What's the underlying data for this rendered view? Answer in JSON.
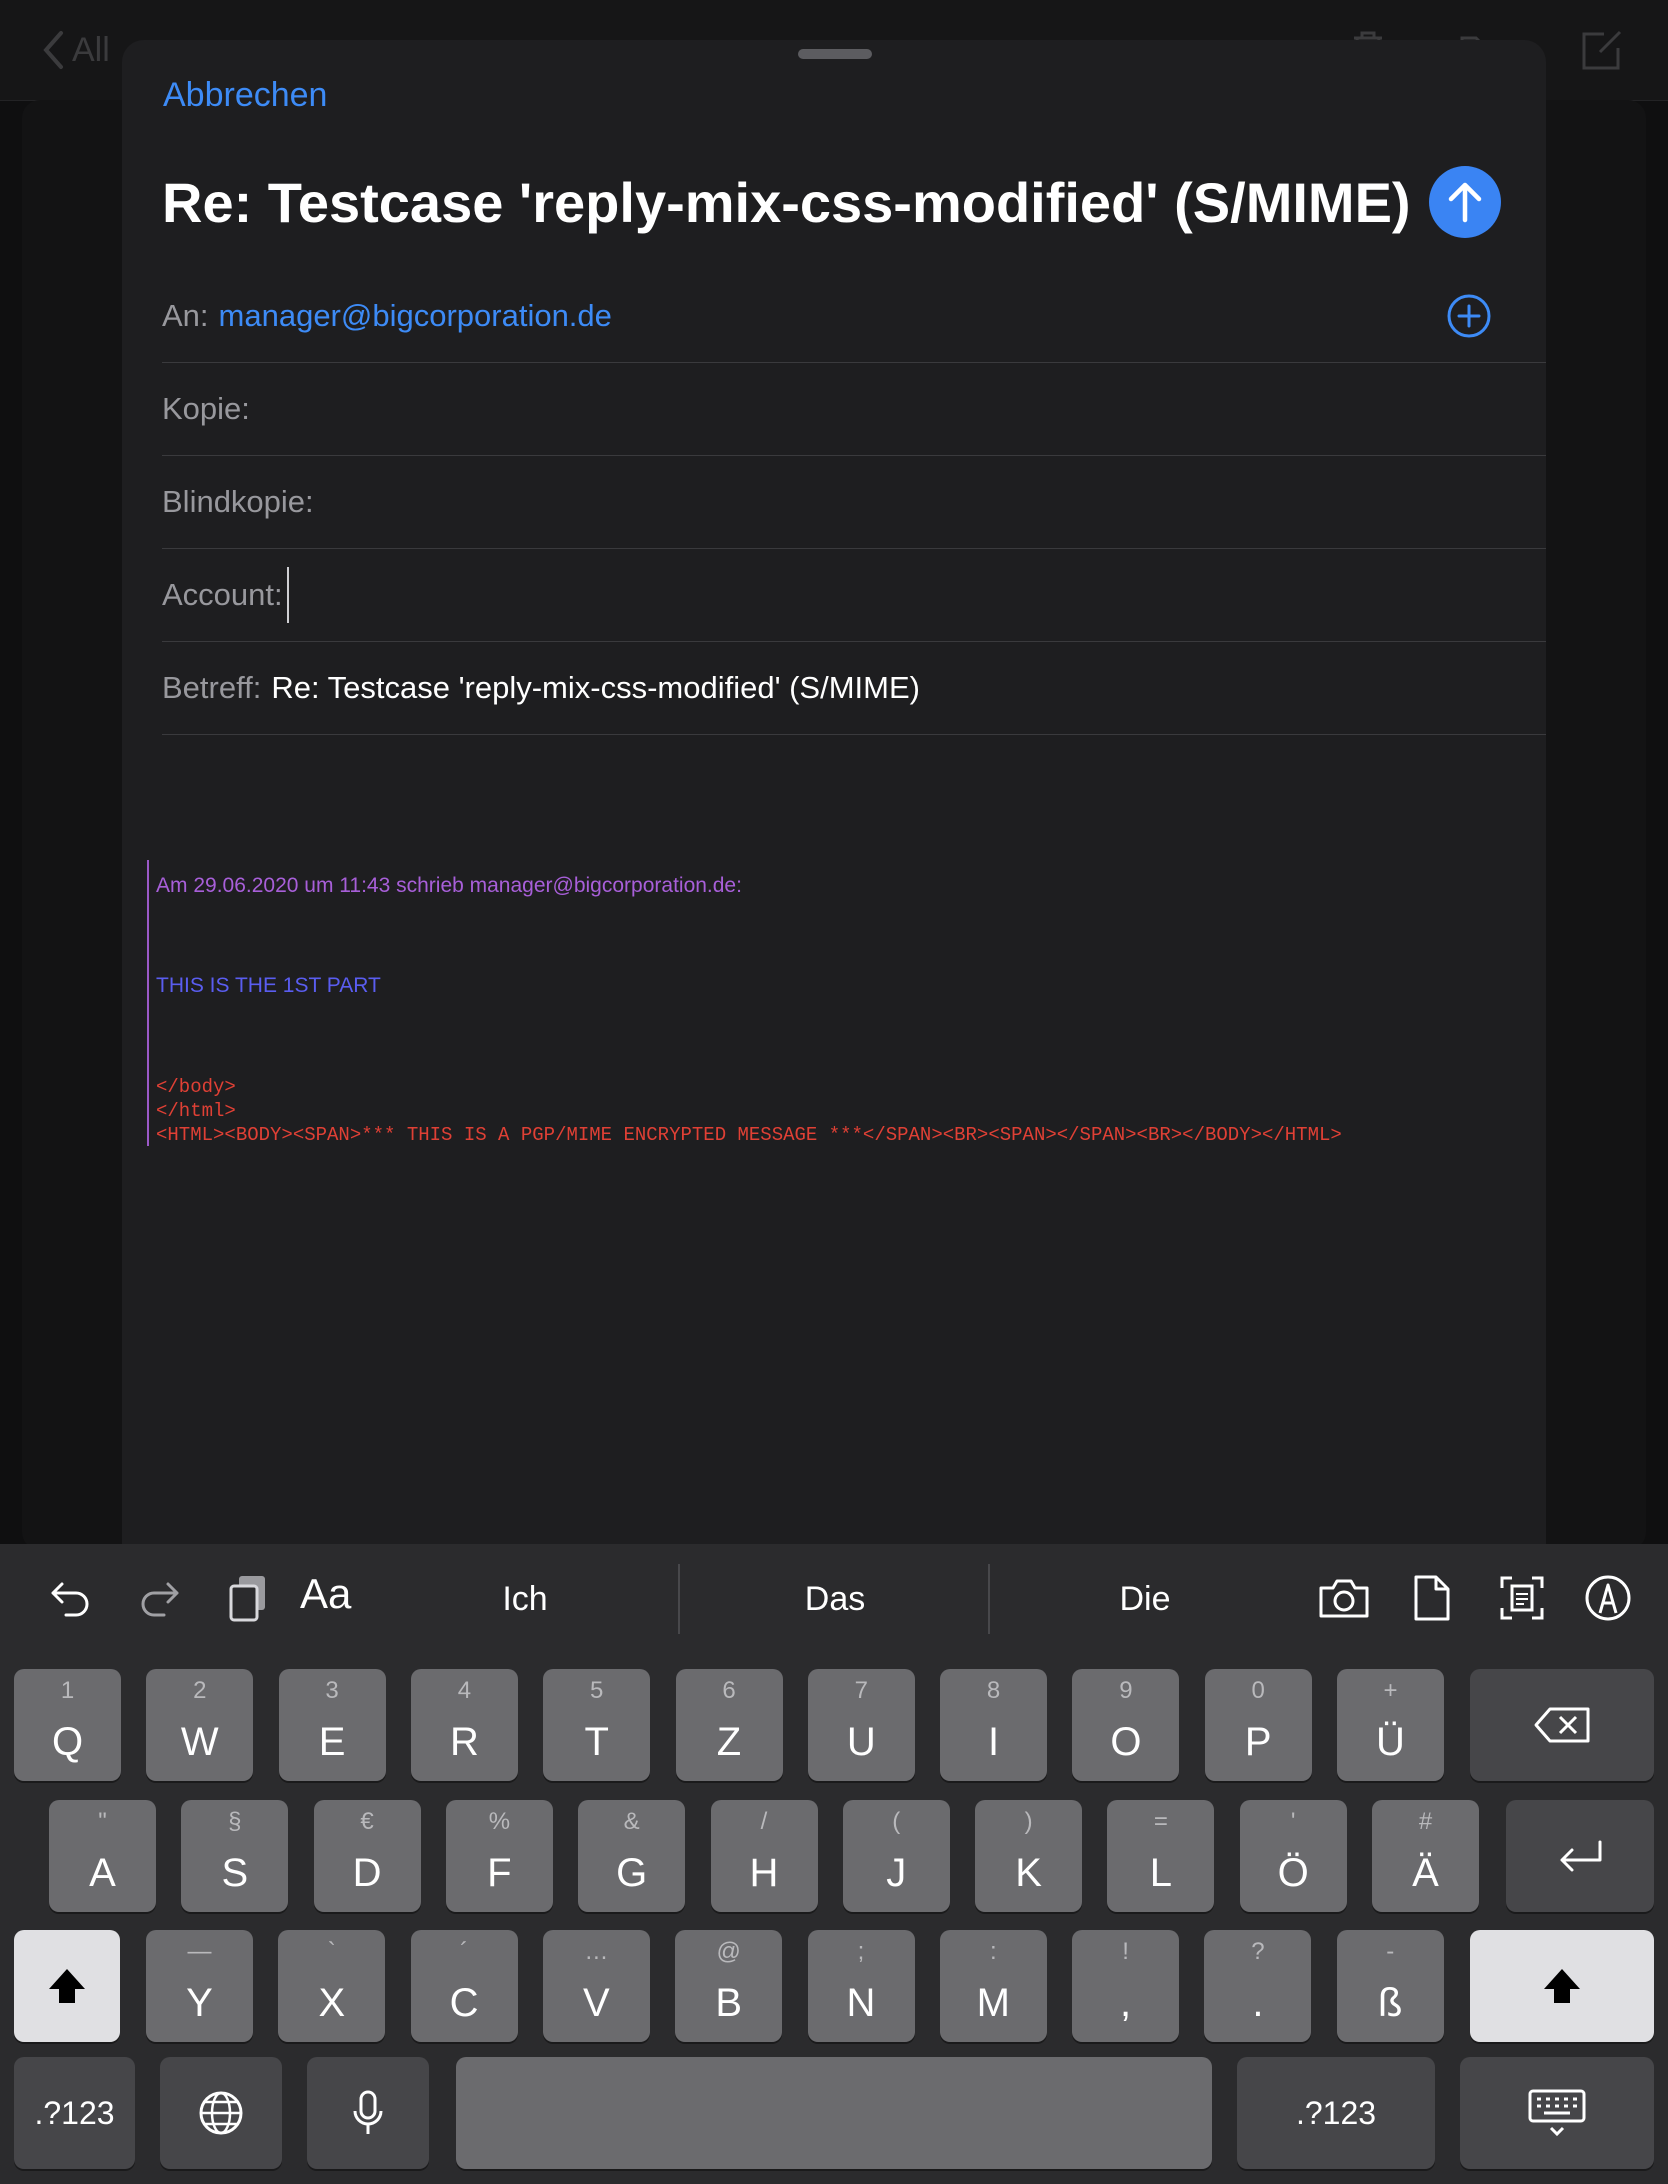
{
  "background": {
    "back_label": "All"
  },
  "compose": {
    "cancel_label": "Abbrechen",
    "title": "Re: Testcase 'reply-mix-css-modified' (S/MIME)",
    "fields": {
      "to_label": "An:",
      "to_value": "manager@bigcorporation.de",
      "cc_label": "Kopie:",
      "bcc_label": "Blindkopie:",
      "account_label": "Account:",
      "subject_label": "Betreff:",
      "subject_value": "Re: Testcase 'reply-mix-css-modified' (S/MIME)"
    },
    "quote": {
      "header": "Am 29.06.2020 um 11:43 schrieb manager@bigcorporation.de:",
      "part": "THIS IS THE 1ST PART",
      "code_lines": [
        "</body>",
        "</html>",
        "<HTML><BODY><SPAN>*** THIS IS A PGP/MIME ENCRYPTED MESSAGE ***</SPAN><BR><SPAN></SPAN><BR></BODY></HTML>"
      ]
    }
  },
  "keyboard": {
    "format_label": "Aa",
    "suggestions": [
      "Ich",
      "Das",
      "Die"
    ],
    "row1": [
      {
        "sec": "1",
        "pri": "Q"
      },
      {
        "sec": "2",
        "pri": "W"
      },
      {
        "sec": "3",
        "pri": "E"
      },
      {
        "sec": "4",
        "pri": "R"
      },
      {
        "sec": "5",
        "pri": "T"
      },
      {
        "sec": "6",
        "pri": "Z"
      },
      {
        "sec": "7",
        "pri": "U"
      },
      {
        "sec": "8",
        "pri": "I"
      },
      {
        "sec": "9",
        "pri": "O"
      },
      {
        "sec": "0",
        "pri": "P"
      },
      {
        "sec": "+",
        "pri": "Ü"
      }
    ],
    "row2": [
      {
        "sec": "\"",
        "pri": "A"
      },
      {
        "sec": "§",
        "pri": "S"
      },
      {
        "sec": "€",
        "pri": "D"
      },
      {
        "sec": "%",
        "pri": "F"
      },
      {
        "sec": "&",
        "pri": "G"
      },
      {
        "sec": "/",
        "pri": "H"
      },
      {
        "sec": "(",
        "pri": "J"
      },
      {
        "sec": ")",
        "pri": "K"
      },
      {
        "sec": "=",
        "pri": "L"
      },
      {
        "sec": "'",
        "pri": "Ö"
      },
      {
        "sec": "#",
        "pri": "Ä"
      }
    ],
    "row3": [
      {
        "sec": "—",
        "pri": "Y"
      },
      {
        "sec": "`",
        "pri": "X"
      },
      {
        "sec": "´",
        "pri": "C"
      },
      {
        "sec": "…",
        "pri": "V"
      },
      {
        "sec": "@",
        "pri": "B"
      },
      {
        "sec": ";",
        "pri": "N"
      },
      {
        "sec": ":",
        "pri": "M"
      },
      {
        "sec": "!",
        "pri": ","
      },
      {
        "sec": "?",
        "pri": "."
      },
      {
        "sec": "-",
        "pri": "ß"
      }
    ],
    "numbers_label": ".?123",
    "icons": {
      "delete": "delete-icon",
      "return": "return-icon",
      "shift": "shift-icon",
      "globe": "globe-icon",
      "mic": "microphone-icon",
      "hide": "keyboard-dismiss-icon"
    }
  },
  "colors": {
    "accent": "#3d8bf6",
    "quote_header": "#a85fd9",
    "quote_part": "#5a5df0",
    "code": "#e04035"
  }
}
